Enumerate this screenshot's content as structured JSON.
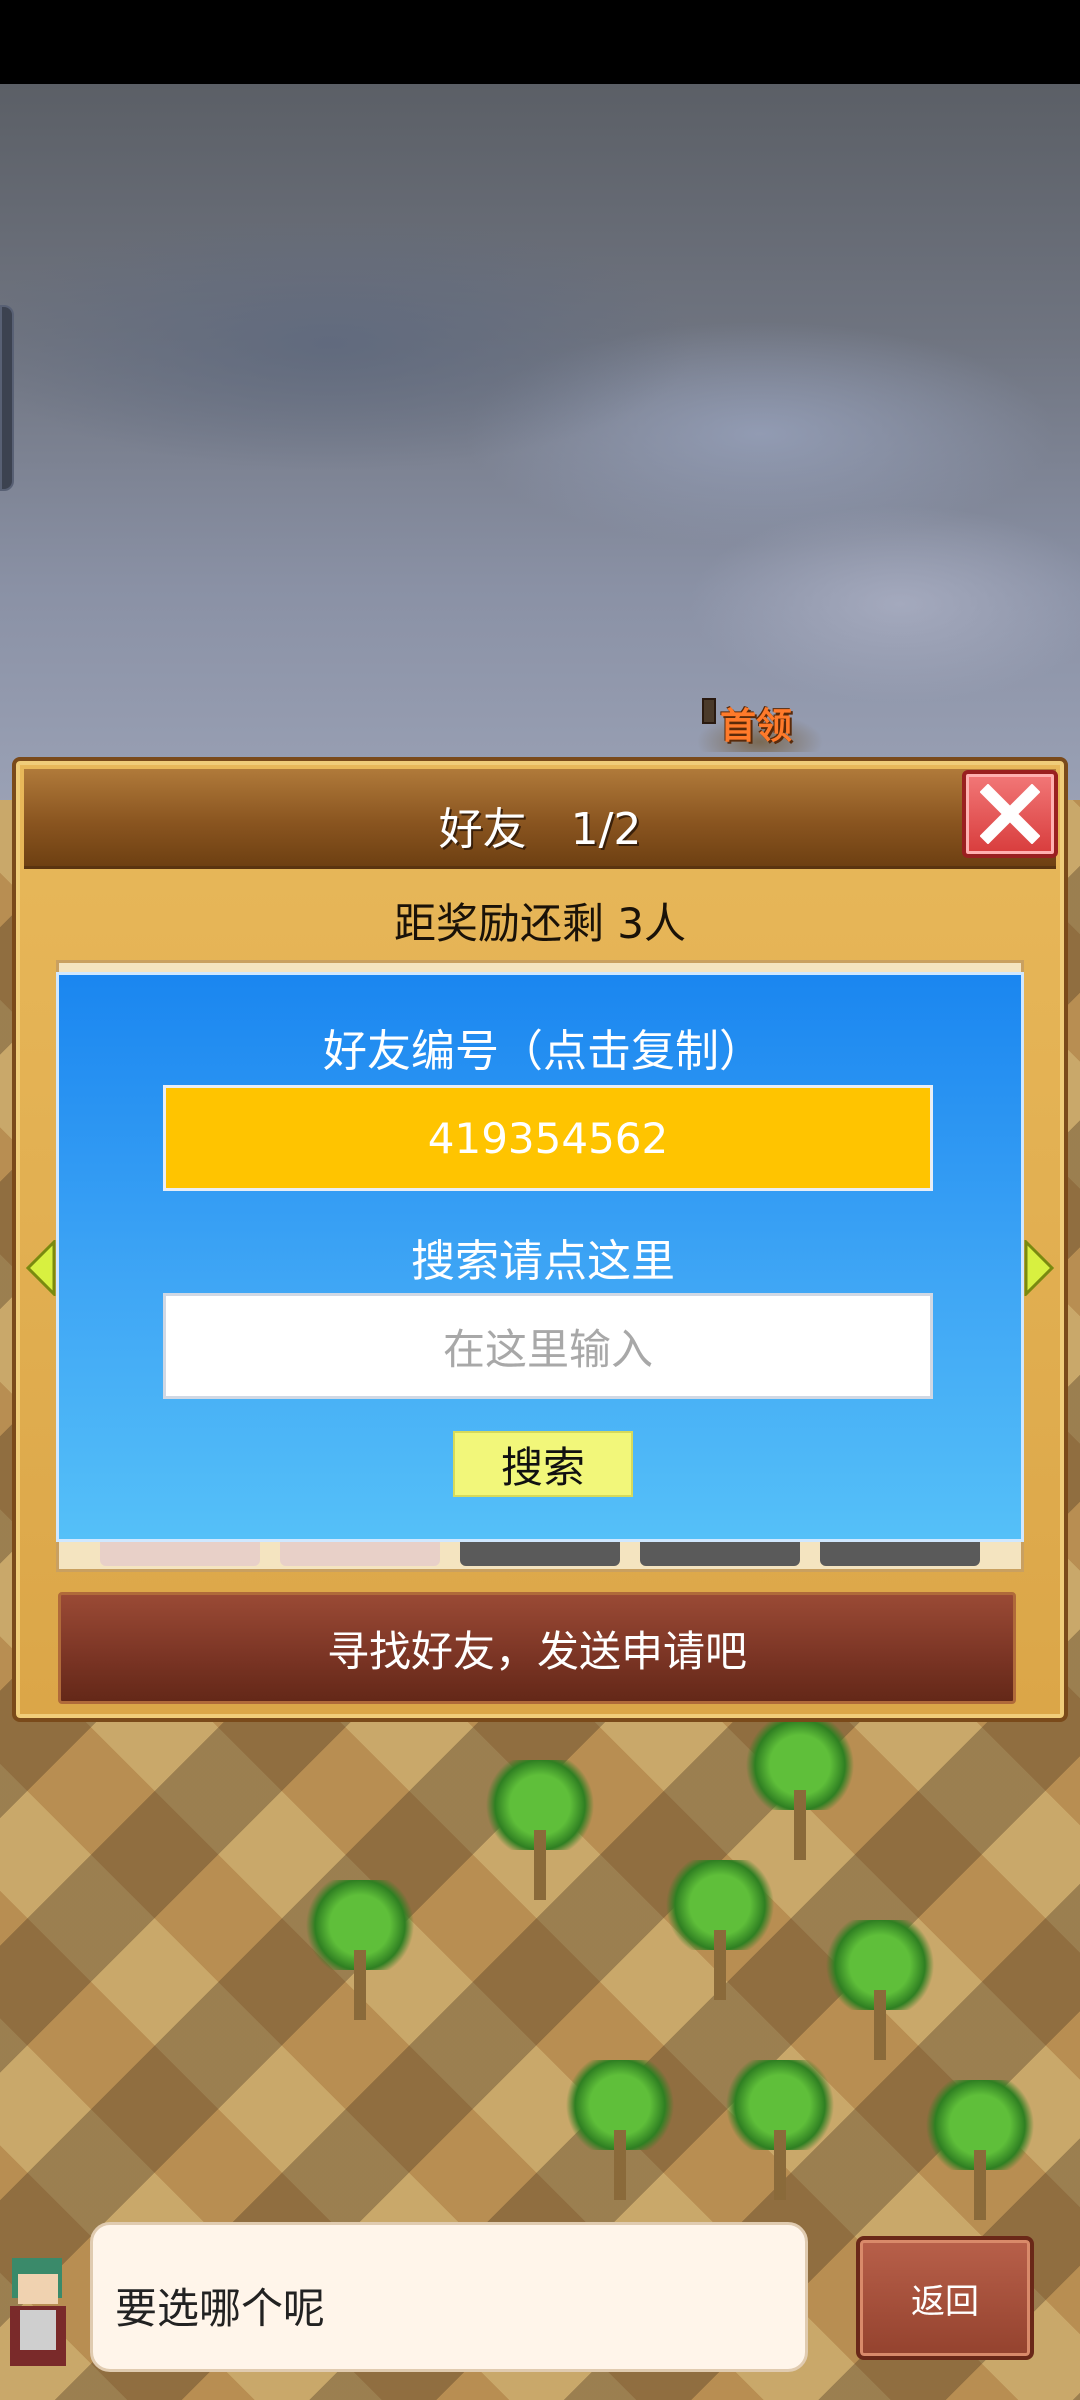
{
  "map": {
    "boss_label": "首领"
  },
  "dialog": {
    "title": "好友　1/2",
    "reward_text": "距奖励还剩 3人",
    "close_icon": "close-icon"
  },
  "friend_popup": {
    "title": "好友编号（点击复制）",
    "friend_id": "419354562",
    "search_hint": "搜索请点这里",
    "search_placeholder": "在这里输入",
    "search_button": "搜索"
  },
  "find_friends_button": "寻找好友，发送申请吧",
  "message": {
    "text": "要选哪个呢",
    "back_button": "返回"
  },
  "colors": {
    "popup_blue": "#1a86f0",
    "id_box_yellow": "#ffc400",
    "search_button_yellow": "#f2f77a",
    "close_red": "#d83c3c",
    "boss_orange": "#ff7a2a"
  }
}
